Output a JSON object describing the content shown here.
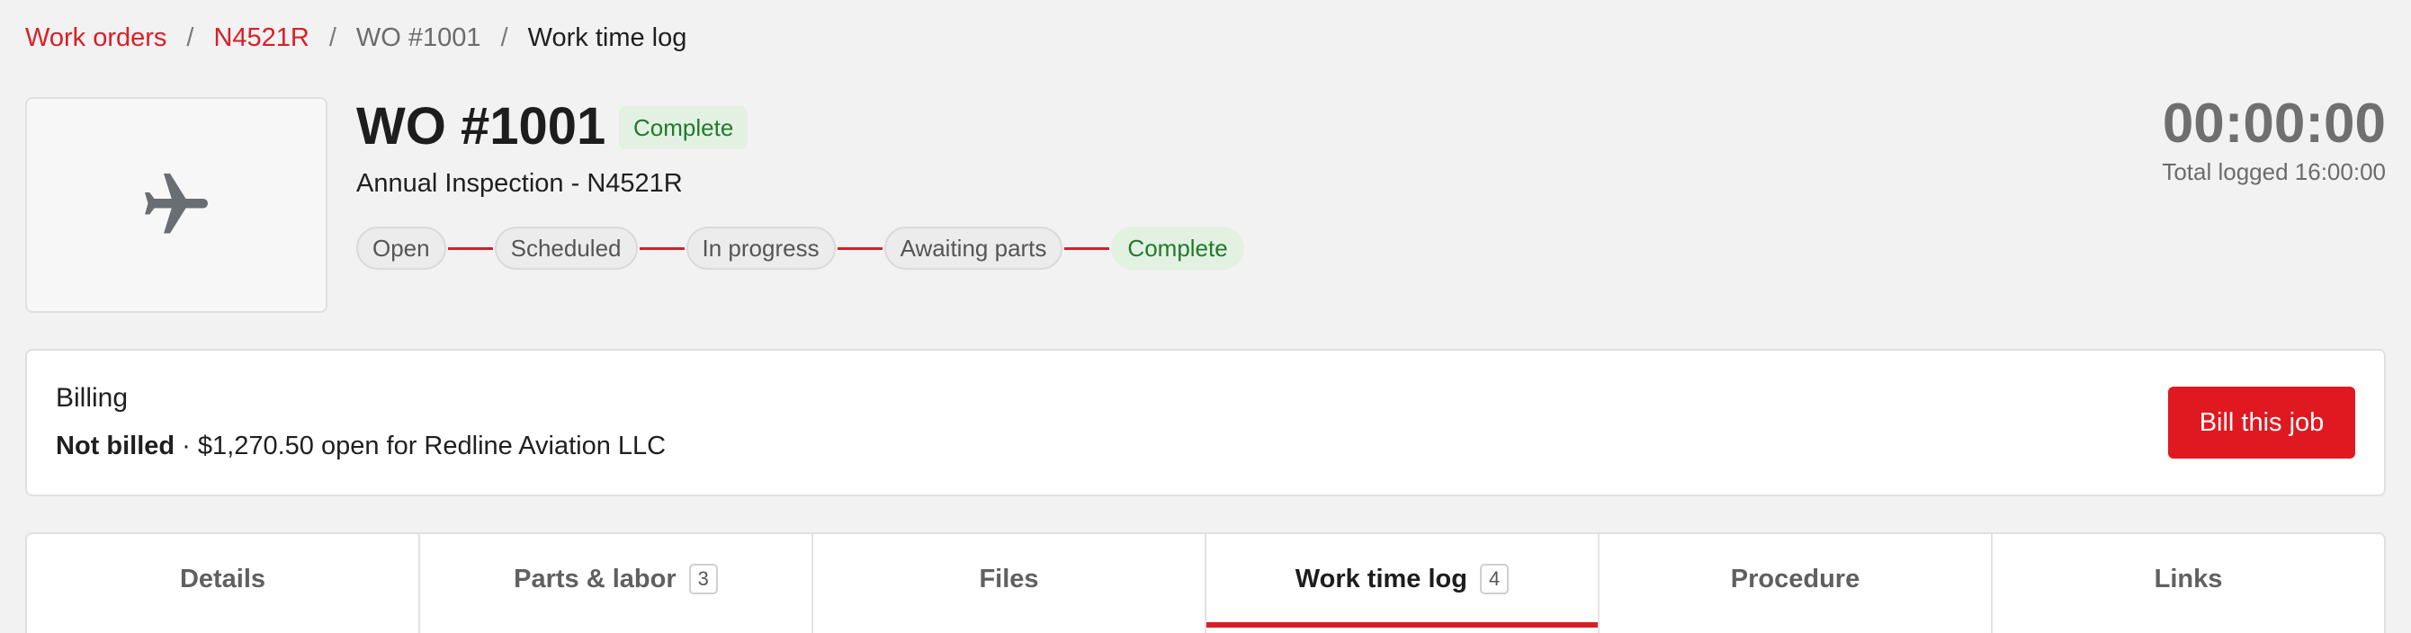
{
  "breadcrumb": {
    "work_orders": "Work orders",
    "aircraft": "N4521R",
    "wo": "WO #1001",
    "current": "Work time log",
    "separator": "/"
  },
  "header": {
    "icon": "airplane-icon",
    "title": "WO #1001",
    "status": "Complete",
    "subtitle": "Annual Inspection - N4521R"
  },
  "progress_steps": [
    "Open",
    "Scheduled",
    "In progress",
    "Awaiting parts",
    "Complete"
  ],
  "timer": {
    "clock": "00:00:00",
    "total": "Total logged 16:00:00"
  },
  "billing": {
    "title": "Billing",
    "status": "Not billed",
    "detail": " · $1,270.50 open for Redline Aviation LLC",
    "button": "Bill this job"
  },
  "tabs": [
    {
      "label": "Details",
      "count": ""
    },
    {
      "label": "Parts & labor",
      "count": "3"
    },
    {
      "label": "Files",
      "count": ""
    },
    {
      "label": "Work time log",
      "count": "4"
    },
    {
      "label": "Procedure",
      "count": ""
    },
    {
      "label": "Links",
      "count": ""
    }
  ],
  "colors": {
    "accent": "#d91f26",
    "success": "#217a2b",
    "success_bg": "#e3f1e3"
  }
}
